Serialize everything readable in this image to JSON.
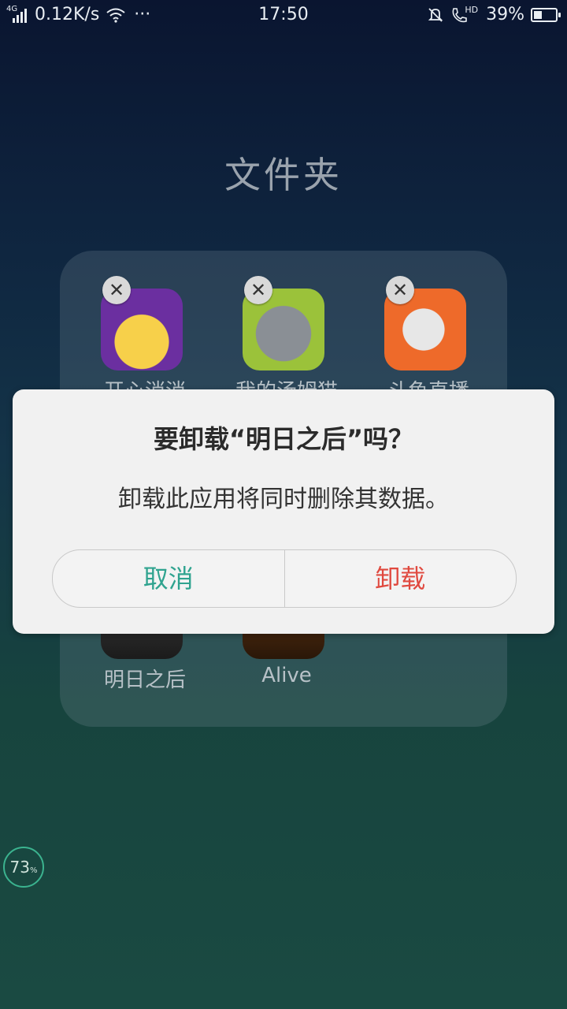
{
  "status_bar": {
    "network_type": "4G",
    "speed": "0.12K/s",
    "more": "···",
    "time": "17:50",
    "hd_label": "HD",
    "battery_percent": "39%",
    "battery_level": 0.39
  },
  "folder": {
    "title": "文件夹",
    "apps": [
      {
        "label": "开心消消",
        "icon": "candy-game-icon"
      },
      {
        "label": "我的汤姆猫",
        "icon": "tom-cat-icon"
      },
      {
        "label": "斗鱼直播",
        "icon": "douyu-icon"
      },
      {
        "label": "明日之后",
        "icon": "lifeafter-icon"
      },
      {
        "label": "Alive",
        "icon": "alive-game-icon"
      }
    ]
  },
  "dialog": {
    "title": "要卸载“明日之后”吗？",
    "message": "卸载此应用将同时删除其数据。",
    "cancel_label": "取消",
    "uninstall_label": "卸载"
  },
  "memory_widget": {
    "value": "73",
    "unit": "%"
  },
  "colors": {
    "accent_green": "#2fa38f",
    "danger_red": "#e0493f"
  }
}
